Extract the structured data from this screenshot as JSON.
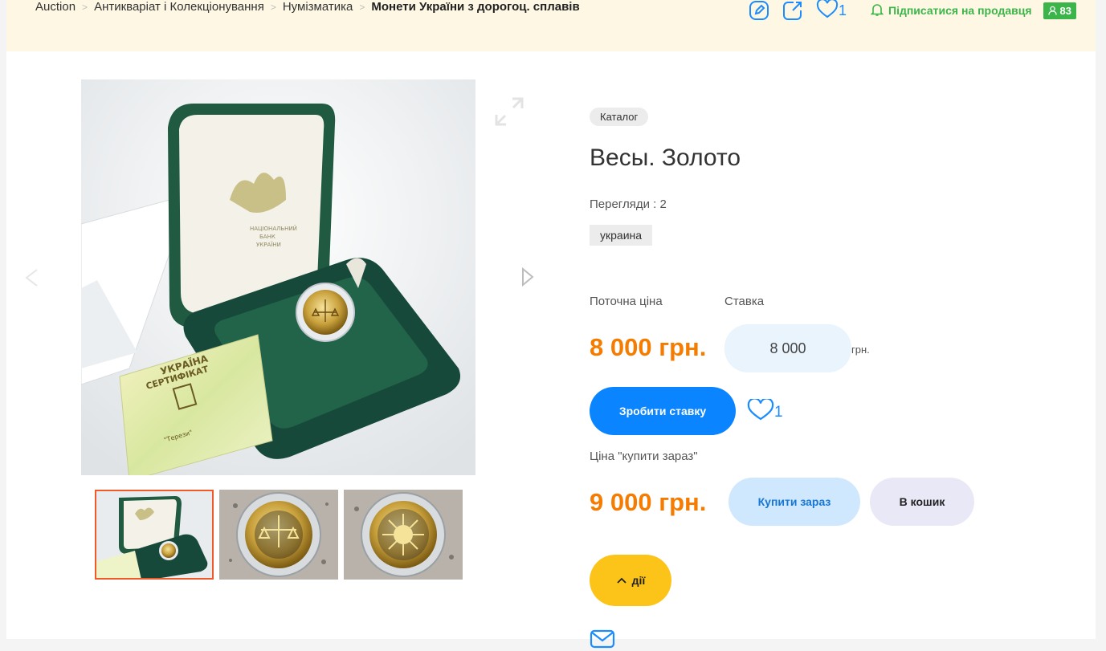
{
  "breadcrumb": {
    "items": [
      "Auction",
      "Антикваріат і Колекціонування",
      "Нумізматика"
    ],
    "current": "Монети України з дорогоц. сплавів"
  },
  "header": {
    "favorites_count": "1",
    "subscribe_label": "Підписатися на продавця",
    "seller_rating": "83",
    "icons": [
      "edit-icon",
      "share-icon",
      "heart-icon",
      "bell-icon",
      "user-icon"
    ]
  },
  "gallery": {
    "thumbnails": [
      "coin-box-photo",
      "coin-reverse-photo",
      "coin-obverse-photo"
    ],
    "active_index": 0
  },
  "product": {
    "catalog_badge": "Каталог",
    "title": "Весы. Золото",
    "views": "Перегляди : 2",
    "tag": "украина",
    "current_price_label": "Поточна ціна",
    "bid_label": "Ставка",
    "current_price": "8 000 грн.",
    "bid_value": "8 000",
    "bid_currency": "грн.",
    "bid_button": "Зробити ставку",
    "favorites_count": "1",
    "buy_now_label": "Ціна \"купити зараз\"",
    "buy_now_price": "9 000 грн.",
    "buy_now_button": "Купити зараз",
    "cart_button": "В кошик",
    "actions_button": "дії"
  },
  "colors": {
    "topbar_bg": "#fdf7e4",
    "accent_blue": "#0a84ff",
    "price_orange": "#f57c00",
    "subscribe_green": "#3bb54a",
    "actions_yellow": "#fcc419"
  }
}
